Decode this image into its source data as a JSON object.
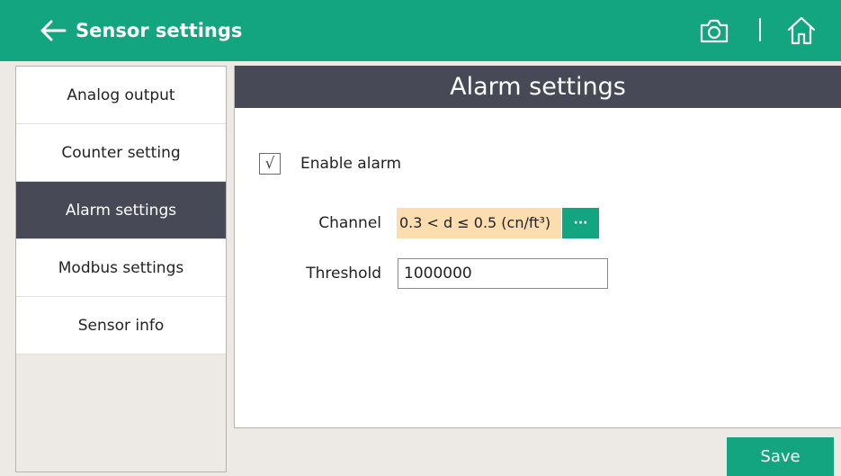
{
  "header": {
    "title": "Sensor settings",
    "back_icon": "arrow-left-icon",
    "camera_icon": "camera-icon",
    "home_icon": "home-icon",
    "color": "#13a57f"
  },
  "sidebar": {
    "items": [
      {
        "label": "Analog output",
        "active": false
      },
      {
        "label": "Counter setting",
        "active": false
      },
      {
        "label": "Alarm settings",
        "active": true
      },
      {
        "label": "Modbus settings",
        "active": false
      },
      {
        "label": "Sensor info",
        "active": false
      }
    ],
    "active_color": "#474a56"
  },
  "panel": {
    "title": "Alarm settings",
    "enable_alarm": {
      "label": "Enable alarm",
      "checked": true,
      "mark": "√"
    },
    "channel": {
      "label": "Channel",
      "value": "0.3 < d ≤ 0.5 (cn/ft³)",
      "more_label": "···"
    },
    "threshold": {
      "label": "Threshold",
      "value": "1000000"
    }
  },
  "footer": {
    "save_label": "Save"
  }
}
